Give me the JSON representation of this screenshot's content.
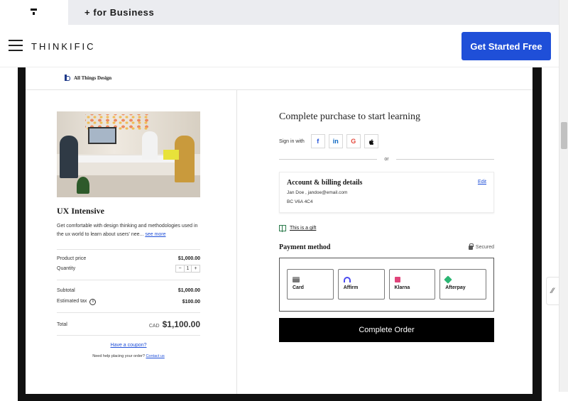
{
  "tabs": {
    "business": "+ for Business"
  },
  "header": {
    "logo": "THINKIFIC",
    "cta": "Get Started Free"
  },
  "school": {
    "name": "All Things Design"
  },
  "course": {
    "title": "UX Intensive",
    "description": "Get comfortable with design thinking and methodologies used in the ux world to learn about users' nee...",
    "see_more": "see more",
    "product_price_label": "Product price",
    "product_price": "$1,000.00",
    "quantity_label": "Quantity",
    "quantity": "1",
    "minus": "−",
    "plus": "+",
    "subtotal_label": "Subtotal",
    "subtotal": "$1,000.00",
    "tax_label": "Estimated tax",
    "tax": "$100.00",
    "total_label": "Total",
    "currency": "CAD",
    "total": "$1,100.00",
    "coupon": "Have a coupon?",
    "help": "Need help placing your order?",
    "contact": "Contact us"
  },
  "checkout": {
    "title": "Complete purchase to start learning",
    "sign_in_label": "Sign in with",
    "social": [
      {
        "glyph": "f",
        "color": "#1f4fd8"
      },
      {
        "glyph": "in",
        "color": "#0a66c2"
      },
      {
        "glyph": "G",
        "color": "#e4483b"
      },
      {
        "glyph": "",
        "color": "#111111"
      }
    ],
    "or": "or",
    "account_title": "Account & billing details",
    "edit": "Edit",
    "account_line1": "Jan Doe , jandoe@email.com",
    "account_line2": "BC V6A 4C4",
    "gift": "This is a gift",
    "payment_title": "Payment method",
    "secured": "Secured",
    "methods": [
      {
        "name": "Card",
        "icon_color": "#777777"
      },
      {
        "name": "Affirm",
        "icon_color": "#4a4af0"
      },
      {
        "name": "Klarna",
        "icon_color": "#e0447a"
      },
      {
        "name": "Afterpay",
        "icon_color": "#2bb673"
      }
    ],
    "complete": "Complete Order"
  },
  "side_handle": "⁄⁄"
}
